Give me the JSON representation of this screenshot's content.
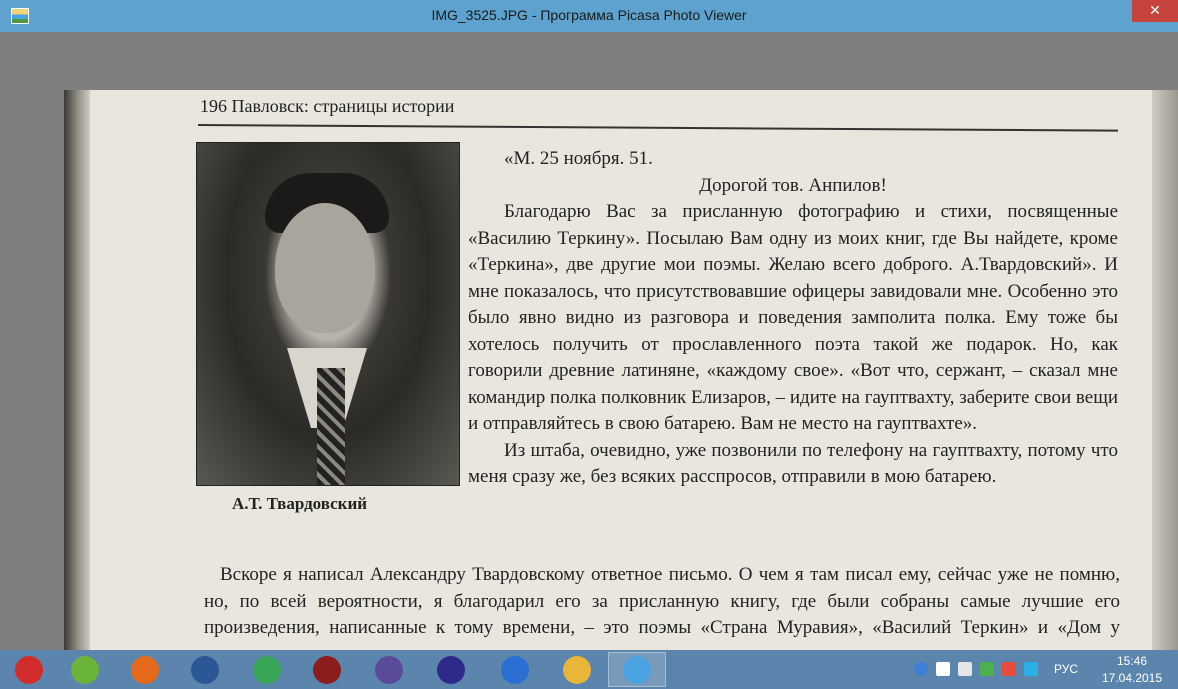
{
  "window": {
    "title": "IMG_3525.JPG - Программа Picasa Photo Viewer",
    "close_glyph": "✕"
  },
  "page": {
    "header": "196   Павловск: страницы истории",
    "caption": "А.Т. Твардовский",
    "paragraphs": [
      "«М. 25 ноября. 51.",
      "Дорогой тов. Анпилов!",
      "Благодарю Вас за присланную фотографию и стихи, посвященные «Василию Теркину». Посылаю Вам одну из моих книг, где Вы найдете, кроме «Теркина», две другие мои поэмы. Желаю всего доброго. А.Твардовский». И мне показалось, что присутствовавшие офицеры завидовали мне. Особенно это было явно видно из разговора и поведения замполита полка. Ему тоже бы хотелось получить от прославленного поэта такой же подарок. Но, как говорили древние латиняне, «каждому свое». «Вот что, сержант, – сказал мне командир полка полковник Елизаров, – идите на гауптвахту, заберите свои вещи и отправляйтесь в свою батарею. Вам не место на гауптвахте».",
      "Из штаба, очевидно, уже позвонили по телефону на гауптвахту, потому что меня сразу же, без всяких расспросов, отправили в мою батарею."
    ],
    "bottom_paragraph": "Вскоре я написал Александру Твардовскому ответное письмо. О чем я там писал ему, сейчас уже не помню, но, по всей вероятности, я благодарил его за присланную книгу, где были собраны самые лучшие его произведения, написанные к тому времени, – это поэмы «Страна Муравия», «Василий Теркин» и «Дом у дороги»."
  },
  "taskbar": {
    "items": [
      {
        "name": "start-logo-icon",
        "color": "#d32c2c"
      },
      {
        "name": "utorrent-icon",
        "color": "#6ab43b"
      },
      {
        "name": "firefox-icon",
        "color": "#e66a1c"
      },
      {
        "name": "word-icon",
        "color": "#2b5797"
      },
      {
        "name": "chrome-icon",
        "color": "#3aa757"
      },
      {
        "name": "game-icon",
        "color": "#8b1d1d"
      },
      {
        "name": "shield-game-icon",
        "color": "#5a4a9a"
      },
      {
        "name": "unreal-icon",
        "color": "#2d2a8a"
      },
      {
        "name": "crescent-app-icon",
        "color": "#2a6fd1"
      },
      {
        "name": "file-explorer-icon",
        "color": "#e8b73a"
      },
      {
        "name": "picasa-viewer-icon",
        "color": "#4aa2e0"
      }
    ],
    "active_index": 10,
    "tray": {
      "language": "РУС",
      "time": "15:46",
      "date": "17.04.2015"
    }
  }
}
